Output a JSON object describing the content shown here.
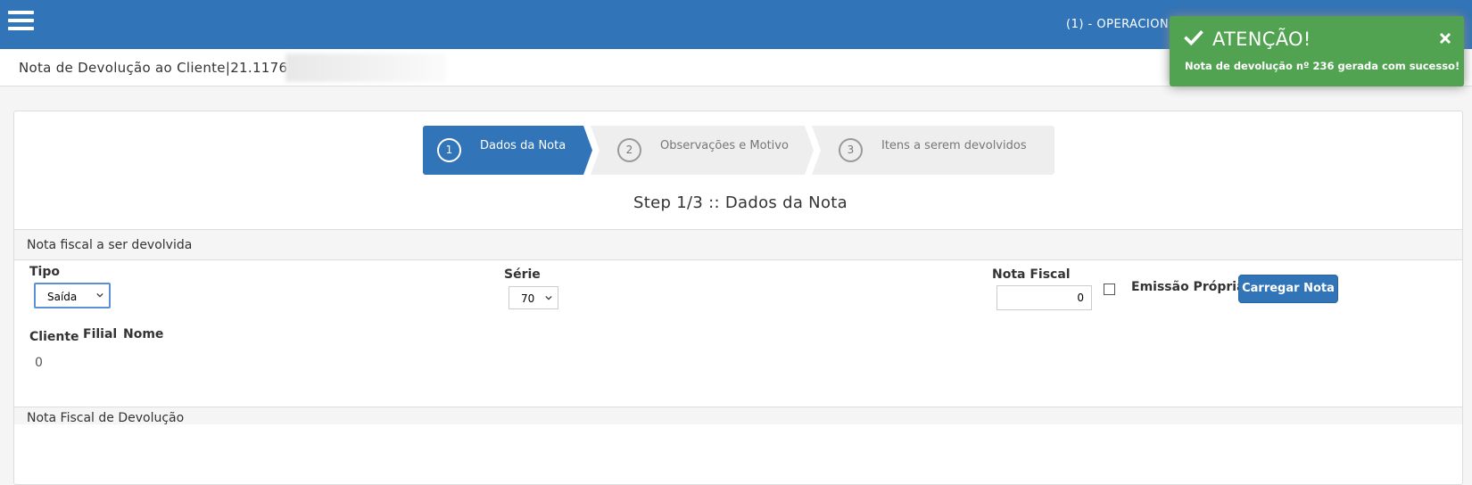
{
  "header": {
    "operation_label": "(1) - OPERACION",
    "page_title": "Nota de Devolução ao Cliente|21.117658"
  },
  "wizard": {
    "steps": [
      {
        "number": "1",
        "label": "Dados da Nota",
        "active": true
      },
      {
        "number": "2",
        "label": "Observações e Motivo",
        "active": false
      },
      {
        "number": "3",
        "label": "Itens a serem devolvidos",
        "active": false
      }
    ],
    "heading": "Step 1/3 :: Dados da Nota"
  },
  "form": {
    "panel_title": "Nota fiscal a ser devolvida",
    "tipo_label": "Tipo",
    "tipo_value": "Saída",
    "serie_label": "Série",
    "serie_value": "70",
    "nota_label": "Nota Fiscal",
    "nota_value": "0",
    "emissao_label": "Emissão Própria",
    "emissao_checked": false,
    "load_button": "Carregar Nota",
    "cliente_label": "Cliente",
    "filial_label": "Filial",
    "nome_label": "Nome",
    "cliente_value": "0"
  },
  "bottom_panel": {
    "title": "Nota Fiscal de Devolução"
  },
  "toast": {
    "title": "ATENÇÃO!",
    "message": "Nota de devolução nº 236 gerada com sucesso!",
    "icon": "check-icon",
    "color": "#51a351"
  },
  "colors": {
    "primary": "#3174b7",
    "success": "#51a351"
  }
}
